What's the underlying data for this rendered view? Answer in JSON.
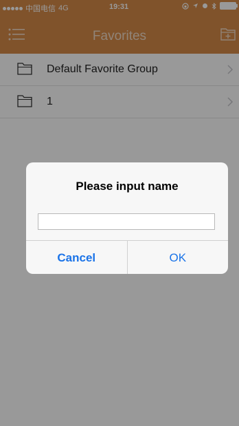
{
  "status_bar": {
    "carrier": "中国电信",
    "network": "4G",
    "time": "19:31"
  },
  "nav": {
    "title": "Favorites",
    "menu_icon": "list-menu-icon",
    "add_icon": "add-folder-icon"
  },
  "list": {
    "items": [
      {
        "label": "Default Favorite Group",
        "icon": "folder-icon"
      },
      {
        "label": "1",
        "icon": "folder-icon"
      }
    ]
  },
  "alert": {
    "title": "Please input name",
    "input_value": "",
    "cancel_label": "Cancel",
    "ok_label": "OK"
  },
  "colors": {
    "header": "#d58a49",
    "accent": "#1a73e8"
  }
}
